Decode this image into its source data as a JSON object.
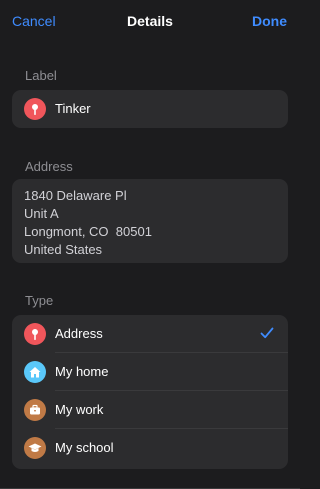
{
  "nav": {
    "cancel_label": "Cancel",
    "title": "Details",
    "done_label": "Done"
  },
  "label_section": {
    "heading": "Label",
    "value": "Tinker",
    "icon": "pin-icon",
    "icon_color": "#f0565b"
  },
  "address_section": {
    "heading": "Address",
    "lines": [
      "1840 Delaware Pl",
      "Unit A",
      "Longmont, CO  80501",
      "United States"
    ]
  },
  "type_section": {
    "heading": "Type",
    "selected": "Address",
    "options": [
      {
        "label": "Address",
        "icon": "pin-icon",
        "color": "#f0565b"
      },
      {
        "label": "My home",
        "icon": "house-icon",
        "color": "#5ac8fa"
      },
      {
        "label": "My work",
        "icon": "briefcase-icon",
        "color": "#c07a46"
      },
      {
        "label": "My school",
        "icon": "graduation-cap-icon",
        "color": "#c07a46"
      }
    ]
  },
  "colors": {
    "accent": "#3f8cff",
    "background": "#1c1c1e",
    "card": "#2c2c2e"
  }
}
